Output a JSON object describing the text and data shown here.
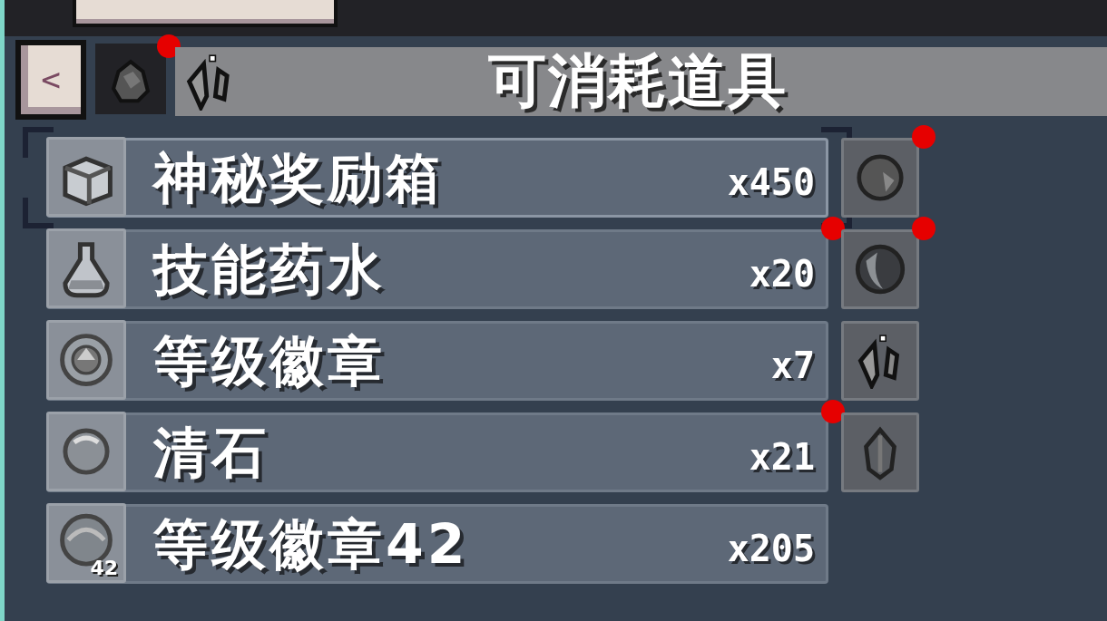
{
  "back_button": {
    "label": "<"
  },
  "category_tabs": [
    {
      "kind": "stone",
      "selected": true,
      "new": true
    }
  ],
  "title": "可消耗道具",
  "items": [
    {
      "name": "神秘奖励箱",
      "count": "x450",
      "selected": true,
      "new": false
    },
    {
      "name": "技能药水",
      "count": "x20",
      "selected": false,
      "new": true
    },
    {
      "name": "等级徽章",
      "count": "x7",
      "selected": false,
      "new": false
    },
    {
      "name": "清石",
      "count": "x21",
      "selected": false,
      "new": true
    },
    {
      "icon_label": "42",
      "name": "等级徽章42",
      "count": "x205",
      "selected": false,
      "new": false
    }
  ],
  "side_slots": [
    {
      "new": true
    },
    {
      "new": true
    },
    {
      "new": false
    },
    {
      "new": false
    }
  ]
}
